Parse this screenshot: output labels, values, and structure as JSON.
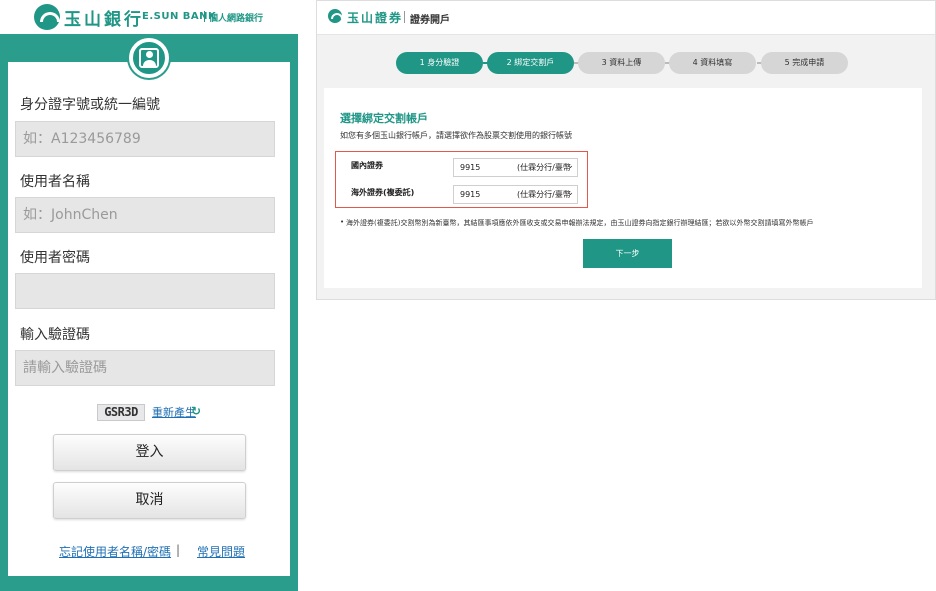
{
  "login": {
    "brand": {
      "name_cn": "玉山銀行",
      "name_en": "E.SUN BANK",
      "subtitle": "個人網路銀行"
    },
    "fields": [
      {
        "label": "身分證字號或統一編號",
        "placeholder": "如：A123456789"
      },
      {
        "label": "使用者名稱",
        "placeholder": "如：JohnChen"
      },
      {
        "label": "使用者密碼",
        "placeholder": ""
      },
      {
        "label": "輸入驗證碼",
        "placeholder": "請輸入驗證碼"
      }
    ],
    "captcha": {
      "code": "GSR3D",
      "regenerate_label": "重新產生"
    },
    "login_button": "登入",
    "cancel_button": "取消",
    "forgot_link": "忘記使用者名稱/密碼",
    "separator": "|",
    "faq_link": "常見問題",
    "colors": {
      "primary": "#2a9d8c",
      "link": "#1f6fb3"
    }
  },
  "account_opening": {
    "brand": {
      "name_cn": "玉山證券"
    },
    "page_title": "證券開戶",
    "steps": [
      {
        "label": "1 身分驗證",
        "state": "done"
      },
      {
        "label": "2 綁定交割戶",
        "state": "current"
      },
      {
        "label": "3 資料上傳",
        "state": "pending"
      },
      {
        "label": "4 資料填寫",
        "state": "pending"
      },
      {
        "label": "5 完成申請",
        "state": "pending"
      }
    ],
    "section_title": "選擇綁定交割帳戶",
    "section_desc": "如您有多個玉山銀行帳戶，請選擇欲作為股票交割使用的銀行帳號",
    "rows": [
      {
        "label": "國內證券",
        "account": "9915",
        "branch": "(仕霖分行/臺幣"
      },
      {
        "label": "海外證券(複委託)",
        "account": "9915",
        "branch": "(仕霖分行/臺幣"
      }
    ],
    "note": "海外證券(複委託)交割幣別為新臺幣，其結匯事項應依外匯收支或交易申報辦法規定，由玉山證券向指定銀行辦理結匯；若欲以外幣交割請填寫外幣帳戶",
    "next_button": "下一步",
    "colors": {
      "primary": "#1f9686",
      "highlight_border": "#e2584b"
    }
  }
}
